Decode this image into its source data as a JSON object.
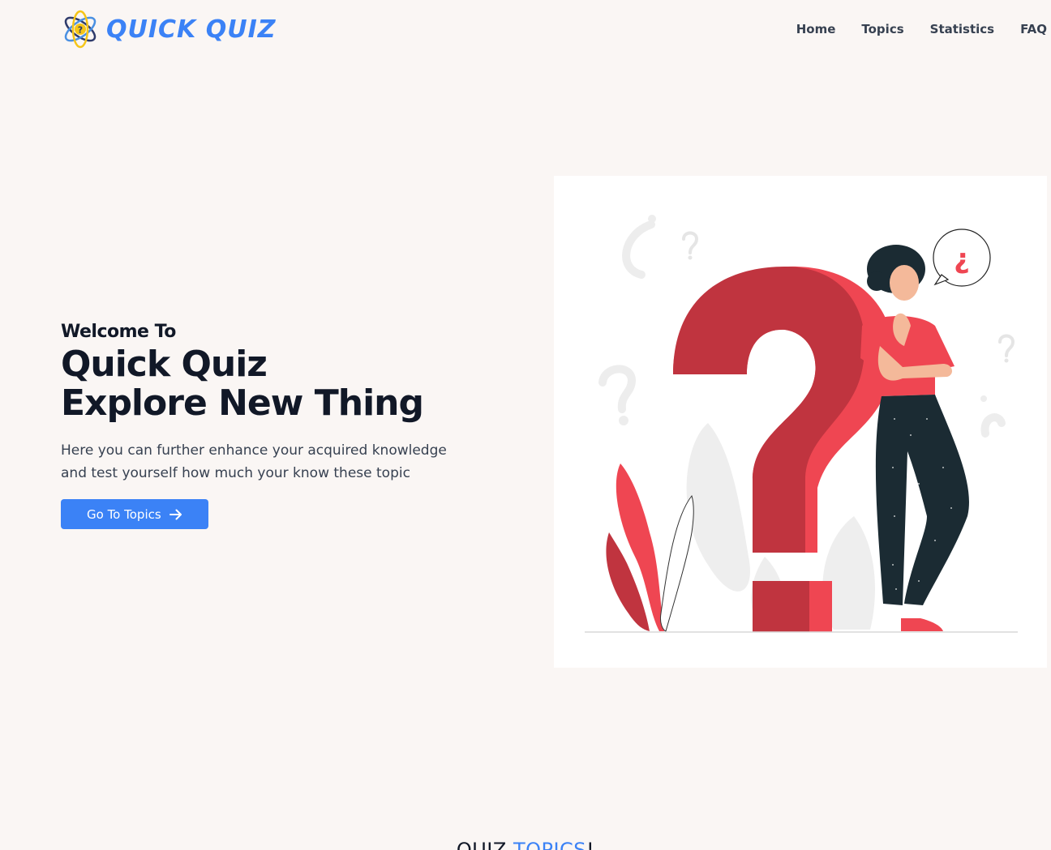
{
  "brand": {
    "name": "QUICK QUIZ",
    "logo_icon": "atom-question-icon",
    "color": "#3b82f6"
  },
  "nav": {
    "items": [
      {
        "label": "Home"
      },
      {
        "label": "Topics"
      },
      {
        "label": "Statistics"
      },
      {
        "label": "FAQ"
      }
    ]
  },
  "hero": {
    "welcome": "Welcome To",
    "title_line1": "Quick Quiz",
    "title_line2": "Explore New Thing",
    "description": "Here you can further enhance your acquired knowledge and test yourself how much your know these topic",
    "cta_label": "Go To Topics",
    "cta_icon": "arrow-right-icon",
    "illustration": "person-thinking-question-mark-illustration",
    "speech_bubble_text": "¿"
  },
  "topics_section": {
    "heading_prefix": "QUIZ ",
    "heading_accent": "TOPICS",
    "heading_suffix": "!"
  },
  "colors": {
    "background": "#faf6f4",
    "accent": "#3b82f6",
    "illustration_red": "#c0343f",
    "illustration_light_red": "#ef4652",
    "pants": "#1b2b33"
  }
}
